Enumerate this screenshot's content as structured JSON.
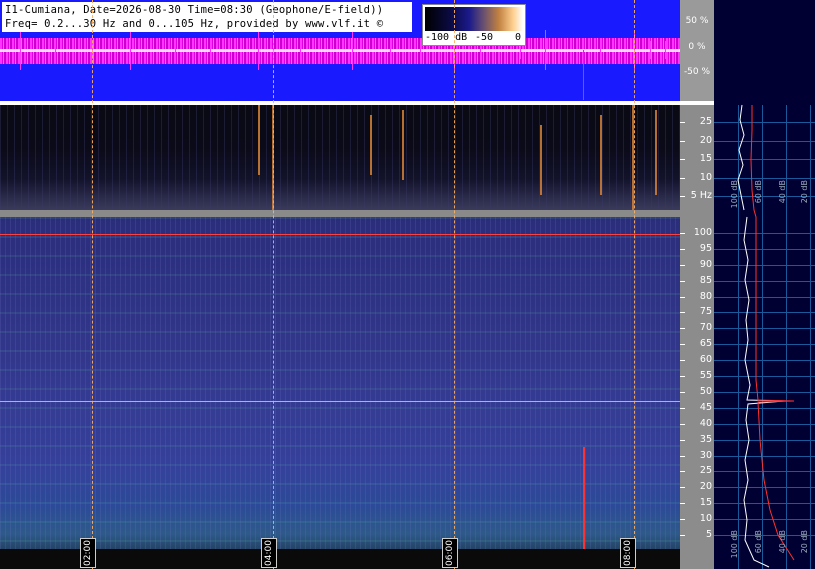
{
  "title": {
    "line1": "I1-Cumiana, Date=2026-08-30 Time=08:30 (Geophone/E-field))",
    "line2": "Freq= 0.2...30 Hz and 0...105 Hz, provided by www.vlf.it ©"
  },
  "colorbar": {
    "label_min": "-100 dB",
    "label_mid": "-50",
    "label_max": "0"
  },
  "waveform_scale": [
    "50 %",
    "0 %",
    "-50 %"
  ],
  "spec_low": {
    "ticks": [
      "25",
      "20",
      "15",
      "10",
      "5 Hz"
    ]
  },
  "spec_high": {
    "ticks": [
      "100",
      "95",
      "90",
      "85",
      "80",
      "75",
      "70",
      "65",
      "60",
      "55",
      "50",
      "45",
      "40",
      "35",
      "30",
      "25",
      "20",
      "15",
      "10",
      "5"
    ]
  },
  "time_labels": [
    "02:00",
    "04:00",
    "06:00",
    "08:00"
  ],
  "profile_labels": {
    "top": [
      "100 dB",
      "60 dB",
      "40 dB",
      "20 dB"
    ],
    "bottom": [
      "100 dB",
      "60 dB",
      "40 dB",
      "20 dB"
    ]
  },
  "colors": {
    "waveform_bg": "#1a1aff",
    "waveform_signal": "#ff33ff",
    "marker_line": "#ff3030",
    "grid": "#1a5a9a"
  }
}
